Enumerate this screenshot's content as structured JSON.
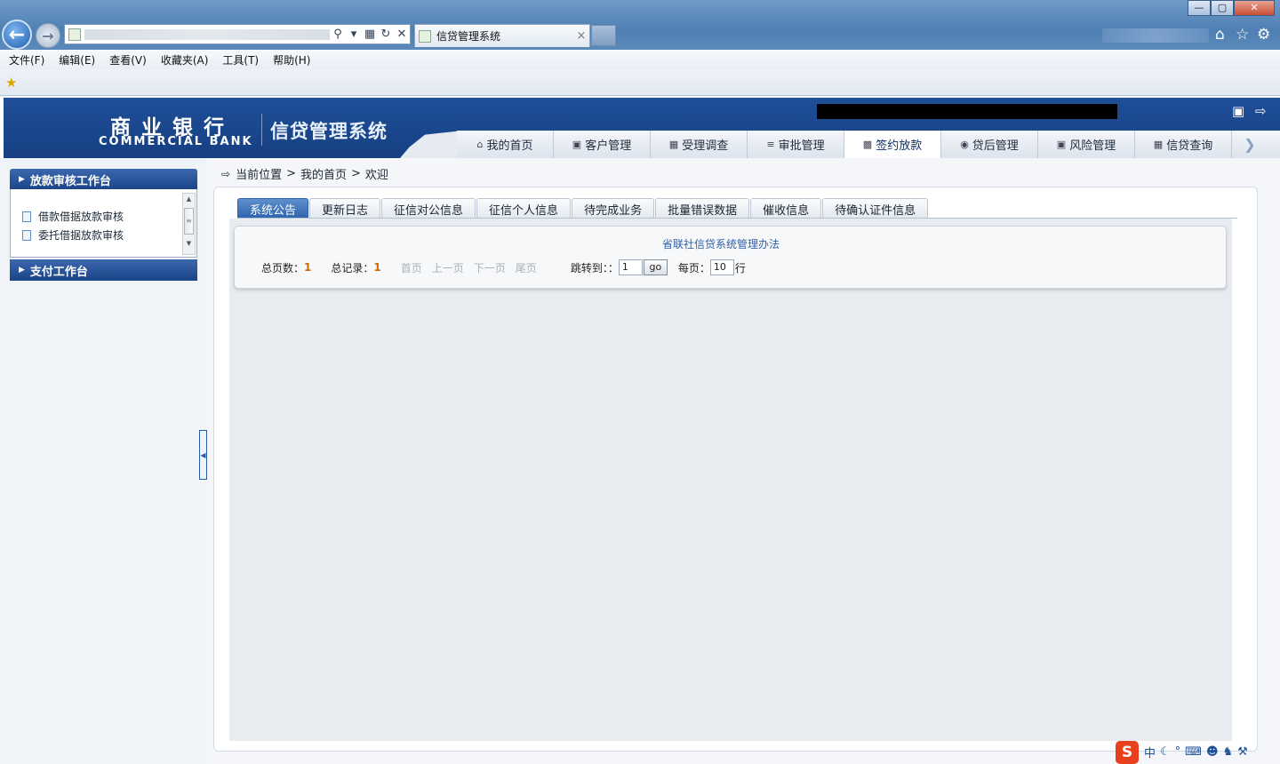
{
  "browser": {
    "tab_title": "信贷管理系统",
    "tab_close": "×",
    "window_buttons": {
      "minimize": "—",
      "maximize": "▢",
      "close": "✕"
    },
    "menu": [
      "文件(F)",
      "编辑(E)",
      "查看(V)",
      "收藏夹(A)",
      "工具(T)",
      "帮助(H)"
    ]
  },
  "header": {
    "logo_cn": "商业银行",
    "logo_en": "COMMERCIAL BANK",
    "system_title": "信贷管理系统"
  },
  "nav": {
    "items": [
      {
        "label": "我的首页",
        "icon": "home-icon"
      },
      {
        "label": "客户管理",
        "icon": "customer-icon"
      },
      {
        "label": "受理调查",
        "icon": "survey-icon"
      },
      {
        "label": "审批管理",
        "icon": "approval-icon"
      },
      {
        "label": "签约放款",
        "icon": "contract-icon"
      },
      {
        "label": "贷后管理",
        "icon": "postloan-icon"
      },
      {
        "label": "风险管理",
        "icon": "risk-icon"
      },
      {
        "label": "信贷查询",
        "icon": "query-icon"
      }
    ],
    "active": "签约放款"
  },
  "sidebar": {
    "groups": [
      {
        "title": "放款审核工作台",
        "items": [
          "借款借据放款审核",
          "委托借据放款审核"
        ]
      },
      {
        "title": "支付工作台",
        "items": []
      }
    ]
  },
  "breadcrumb": {
    "label": "当前位置",
    "sep": ">",
    "path1": "我的首页",
    "path2": "欢迎"
  },
  "content_tabs": [
    "系统公告",
    "更新日志",
    "征信对公信息",
    "征信个人信息",
    "待完成业务",
    "批量错误数据",
    "催收信息",
    "待确认证件信息"
  ],
  "active_content_tab": "系统公告",
  "notice": {
    "title": "省联社信贷系统管理办法"
  },
  "pager": {
    "total_pages_label": "总页数：",
    "total_pages": "1",
    "total_records_label": "总记录：",
    "total_records": "1",
    "first": "首页",
    "prev": "上一页",
    "next": "下一页",
    "last": "尾页",
    "jump_label": "跳转到：：",
    "jump_value": "1",
    "go": "go",
    "per_page_label": "每页：",
    "per_page_value": "10",
    "rows_unit": "行"
  },
  "tray": {
    "ime_logo": "S",
    "ime_mode": "中"
  }
}
